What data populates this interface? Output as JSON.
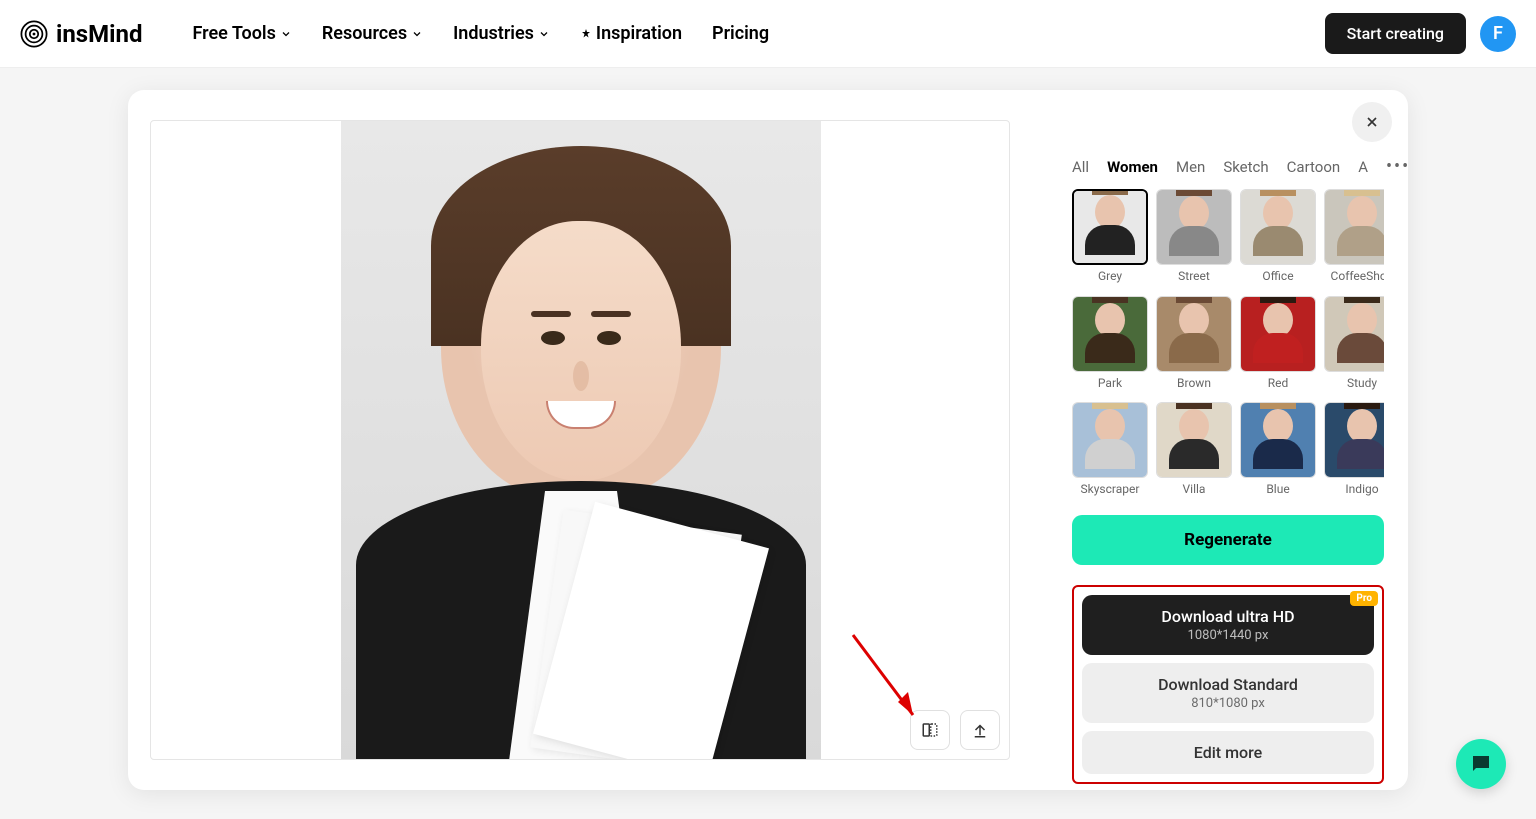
{
  "header": {
    "brand": "insMind",
    "nav": [
      "Free Tools",
      "Resources",
      "Industries",
      "Inspiration",
      "Pricing"
    ],
    "nav_dropdown": [
      true,
      true,
      true,
      false,
      false
    ],
    "cta": "Start creating",
    "avatar_letter": "F"
  },
  "tabs": [
    "All",
    "Women",
    "Men",
    "Sketch",
    "Cartoon",
    "A"
  ],
  "active_tab": 1,
  "styles": [
    {
      "label": "Grey",
      "bg": "#e8e8e8",
      "hair": "#8a6a4a",
      "body": "#222",
      "selected": true
    },
    {
      "label": "Street",
      "bg": "#bcbcbc",
      "hair": "#6b4a35",
      "body": "#888"
    },
    {
      "label": "Office",
      "bg": "#dcdad4",
      "hair": "#b89060",
      "body": "#9a8a70"
    },
    {
      "label": "CoffeeShop",
      "bg": "#cac6bc",
      "hair": "#d8c090",
      "body": "#b0a088"
    },
    {
      "label": "Park",
      "bg": "#4a6a3a",
      "hair": "#4a3222",
      "body": "#3a2a1a"
    },
    {
      "label": "Brown",
      "bg": "#a88a6a",
      "hair": "#6b4a35",
      "body": "#8a6a4a"
    },
    {
      "label": "Red",
      "bg": "#b82020",
      "hair": "#2a1a10",
      "body": "#c02020"
    },
    {
      "label": "Study",
      "bg": "#d0c8b8",
      "hair": "#3a2a1a",
      "body": "#6a4a3a"
    },
    {
      "label": "Skyscraper",
      "bg": "#a8c0d8",
      "hair": "#d8c090",
      "body": "#d0d0d0"
    },
    {
      "label": "Villa",
      "bg": "#e0d8c8",
      "hair": "#4a3222",
      "body": "#2a2a2a"
    },
    {
      "label": "Blue",
      "bg": "#5080b0",
      "hair": "#b89060",
      "body": "#1a2a4a"
    },
    {
      "label": "Indigo",
      "bg": "#2a4a6a",
      "hair": "#2a1a10",
      "body": "#3a3a5a"
    }
  ],
  "regenerate_label": "Regenerate",
  "download": {
    "hd_title": "Download ultra HD",
    "hd_sub": "1080*1440 px",
    "pro": "Pro",
    "std_title": "Download Standard",
    "std_sub": "810*1080 px",
    "edit": "Edit more"
  }
}
